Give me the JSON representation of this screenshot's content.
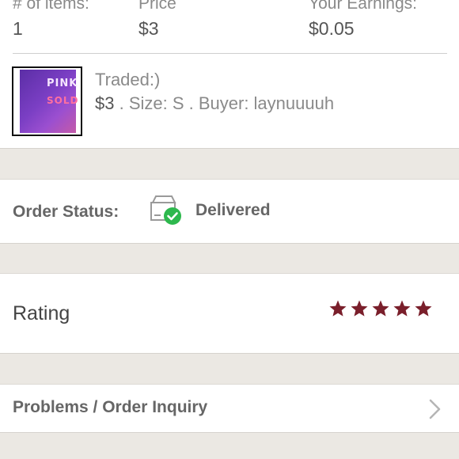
{
  "summary": {
    "items_header": "# of items:",
    "items_value": "1",
    "price_header": "Price",
    "price_value": "$3",
    "earnings_header": "Your Earnings:",
    "earnings_value": "$0.05"
  },
  "item": {
    "thumbnail_text_1": "PINK",
    "thumbnail_text_2": "SOLD",
    "title": "Traded:)",
    "price": "$3",
    "meta": " . Size: S . Buyer: laynuuuuh"
  },
  "order_status": {
    "label": "Order Status:",
    "icon": "package-delivered-icon",
    "value": "Delivered",
    "check_color": "#2db84d"
  },
  "rating": {
    "label": "Rating",
    "stars": 5,
    "max_stars": 5,
    "star_color": "#7a1f2b"
  },
  "problems": {
    "label": "Problems / Order Inquiry",
    "icon": "chevron-right-icon"
  }
}
